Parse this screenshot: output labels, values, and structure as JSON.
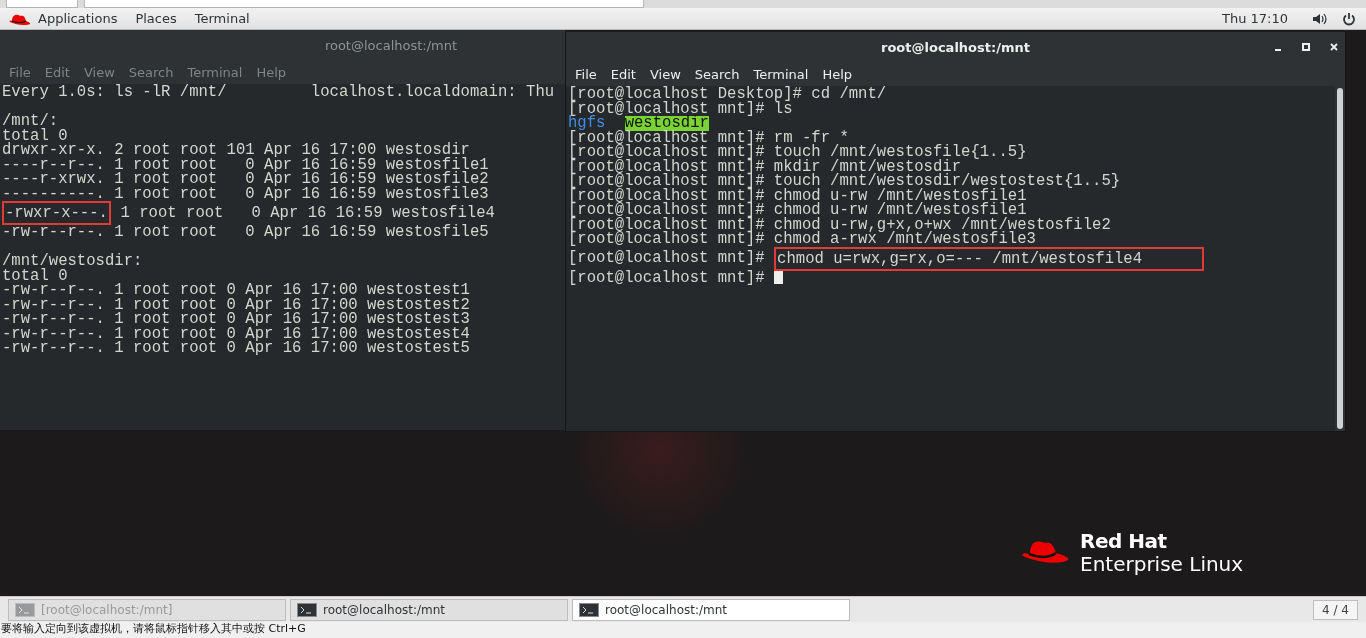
{
  "top_bar": {
    "menus": [
      "Applications",
      "Places",
      "Terminal"
    ],
    "clock": "Thu 17:10"
  },
  "windows": [
    {
      "title": "root@localhost:/mnt",
      "active": false,
      "menu": [
        "File",
        "Edit",
        "View",
        "Search",
        "Terminal",
        "Help"
      ],
      "lines": [
        {
          "kind": "text",
          "segments": [
            {
              "kind": "plain",
              "text": "Every 1.0s: ls -lR /mnt/         localhost.localdomain: Thu"
            }
          ]
        },
        {
          "kind": "blank"
        },
        {
          "kind": "text",
          "segments": [
            {
              "kind": "plain",
              "text": "/mnt/:"
            }
          ]
        },
        {
          "kind": "text",
          "segments": [
            {
              "kind": "plain",
              "text": "total 0"
            }
          ]
        },
        {
          "kind": "text",
          "segments": [
            {
              "kind": "plain",
              "text": "drwxr-xr-x. 2 root root 101 Apr 16 17:00 westosdir"
            }
          ]
        },
        {
          "kind": "text",
          "segments": [
            {
              "kind": "plain",
              "text": "----r--r--. 1 root root   0 Apr 16 16:59 westosfile1"
            }
          ]
        },
        {
          "kind": "text",
          "segments": [
            {
              "kind": "plain",
              "text": "----r-xrwx. 1 root root   0 Apr 16 16:59 westosfile2"
            }
          ]
        },
        {
          "kind": "text",
          "segments": [
            {
              "kind": "plain",
              "text": "----------. 1 root root   0 Apr 16 16:59 westosfile3"
            }
          ]
        },
        {
          "kind": "text",
          "segments": [
            {
              "kind": "annotated",
              "text": "-rwxr-x---."
            },
            {
              "kind": "plain",
              "text": "1 root root   0 Apr 16 16:59 westosfile4"
            }
          ]
        },
        {
          "kind": "text",
          "segments": [
            {
              "kind": "plain",
              "text": "-rw-r--r--. 1 root root   0 Apr 16 16:59 westosfile5"
            }
          ]
        },
        {
          "kind": "blank"
        },
        {
          "kind": "text",
          "segments": [
            {
              "kind": "plain",
              "text": "/mnt/westosdir:"
            }
          ]
        },
        {
          "kind": "text",
          "segments": [
            {
              "kind": "plain",
              "text": "total 0"
            }
          ]
        },
        {
          "kind": "text",
          "segments": [
            {
              "kind": "plain",
              "text": "-rw-r--r--. 1 root root 0 Apr 16 17:00 westostest1"
            }
          ]
        },
        {
          "kind": "text",
          "segments": [
            {
              "kind": "plain",
              "text": "-rw-r--r--. 1 root root 0 Apr 16 17:00 westostest2"
            }
          ]
        },
        {
          "kind": "text",
          "segments": [
            {
              "kind": "plain",
              "text": "-rw-r--r--. 1 root root 0 Apr 16 17:00 westostest3"
            }
          ]
        },
        {
          "kind": "text",
          "segments": [
            {
              "kind": "plain",
              "text": "-rw-r--r--. 1 root root 0 Apr 16 17:00 westostest4"
            }
          ]
        },
        {
          "kind": "text",
          "segments": [
            {
              "kind": "plain",
              "text": "-rw-r--r--. 1 root root 0 Apr 16 17:00 westostest5"
            }
          ]
        }
      ]
    },
    {
      "title": "root@localhost:/mnt",
      "active": true,
      "menu": [
        "File",
        "Edit",
        "View",
        "Search",
        "Terminal",
        "Help"
      ],
      "lines": [
        {
          "kind": "text",
          "cursor": false,
          "segments": [
            {
              "kind": "plain",
              "text": "[root@localhost Desktop]# cd /mnt/"
            }
          ]
        },
        {
          "kind": "text",
          "cursor": false,
          "segments": [
            {
              "kind": "plain",
              "text": "[root@localhost mnt]# ls"
            }
          ]
        },
        {
          "kind": "text",
          "cursor": false,
          "segments": [
            {
              "kind": "dir",
              "text": "hgfs"
            },
            {
              "kind": "dir-sticky",
              "text": "westosdir"
            }
          ]
        },
        {
          "kind": "text",
          "cursor": false,
          "segments": [
            {
              "kind": "plain",
              "text": "[root@localhost mnt]# rm -fr *"
            }
          ]
        },
        {
          "kind": "text",
          "cursor": false,
          "segments": [
            {
              "kind": "plain",
              "text": "[root@localhost mnt]# touch /mnt/westosfile{1..5}"
            }
          ]
        },
        {
          "kind": "text",
          "cursor": false,
          "segments": [
            {
              "kind": "plain",
              "text": "[root@localhost mnt]# mkdir /mnt/westosdir"
            }
          ]
        },
        {
          "kind": "text",
          "cursor": false,
          "segments": [
            {
              "kind": "plain",
              "text": "[root@localhost mnt]# touch /mnt/westosdir/westostest{1..5}"
            }
          ]
        },
        {
          "kind": "text",
          "cursor": false,
          "segments": [
            {
              "kind": "plain",
              "text": "[root@localhost mnt]# chmod u-rw /mnt/westosfile1"
            }
          ]
        },
        {
          "kind": "text",
          "cursor": false,
          "segments": [
            {
              "kind": "plain",
              "text": "[root@localhost mnt]# chmod u-rw /mnt/westosfile1"
            }
          ]
        },
        {
          "kind": "text",
          "cursor": false,
          "segments": [
            {
              "kind": "plain",
              "text": "[root@localhost mnt]# chmod u-rw,g+x,o+wx /mnt/westosfile2"
            }
          ]
        },
        {
          "kind": "text",
          "cursor": false,
          "segments": [
            {
              "kind": "plain",
              "text": "[root@localhost mnt]# chmod a-rwx /mnt/westosfile3"
            }
          ]
        },
        {
          "kind": "text",
          "cursor": false,
          "segments": [
            {
              "kind": "plain",
              "text": "[root@localhost mnt]#"
            },
            {
              "kind": "annotated",
              "text": "chmod u=rwx,g=rx,o=--- /mnt/westosfile4"
            }
          ]
        },
        {
          "kind": "text",
          "cursor": true,
          "segments": [
            {
              "kind": "plain",
              "text": "[root@localhost mnt]#"
            }
          ]
        }
      ]
    }
  ],
  "logo": {
    "line_1": "Red Hat",
    "line_2": "Enterprise Linux"
  },
  "taskbar": {
    "items": [
      {
        "label": "[root@localhost:/mnt]",
        "minimized": true,
        "selected": false
      },
      {
        "label": "root@localhost:/mnt",
        "minimized": false,
        "selected": false
      },
      {
        "label": "root@localhost:/mnt",
        "minimized": false,
        "selected": true
      }
    ],
    "workspace": "4 / 4"
  },
  "status_bar": {
    "message": "要将输入定向到该虚拟机，请将鼠标指针移入其中或按 Ctrl+G"
  }
}
